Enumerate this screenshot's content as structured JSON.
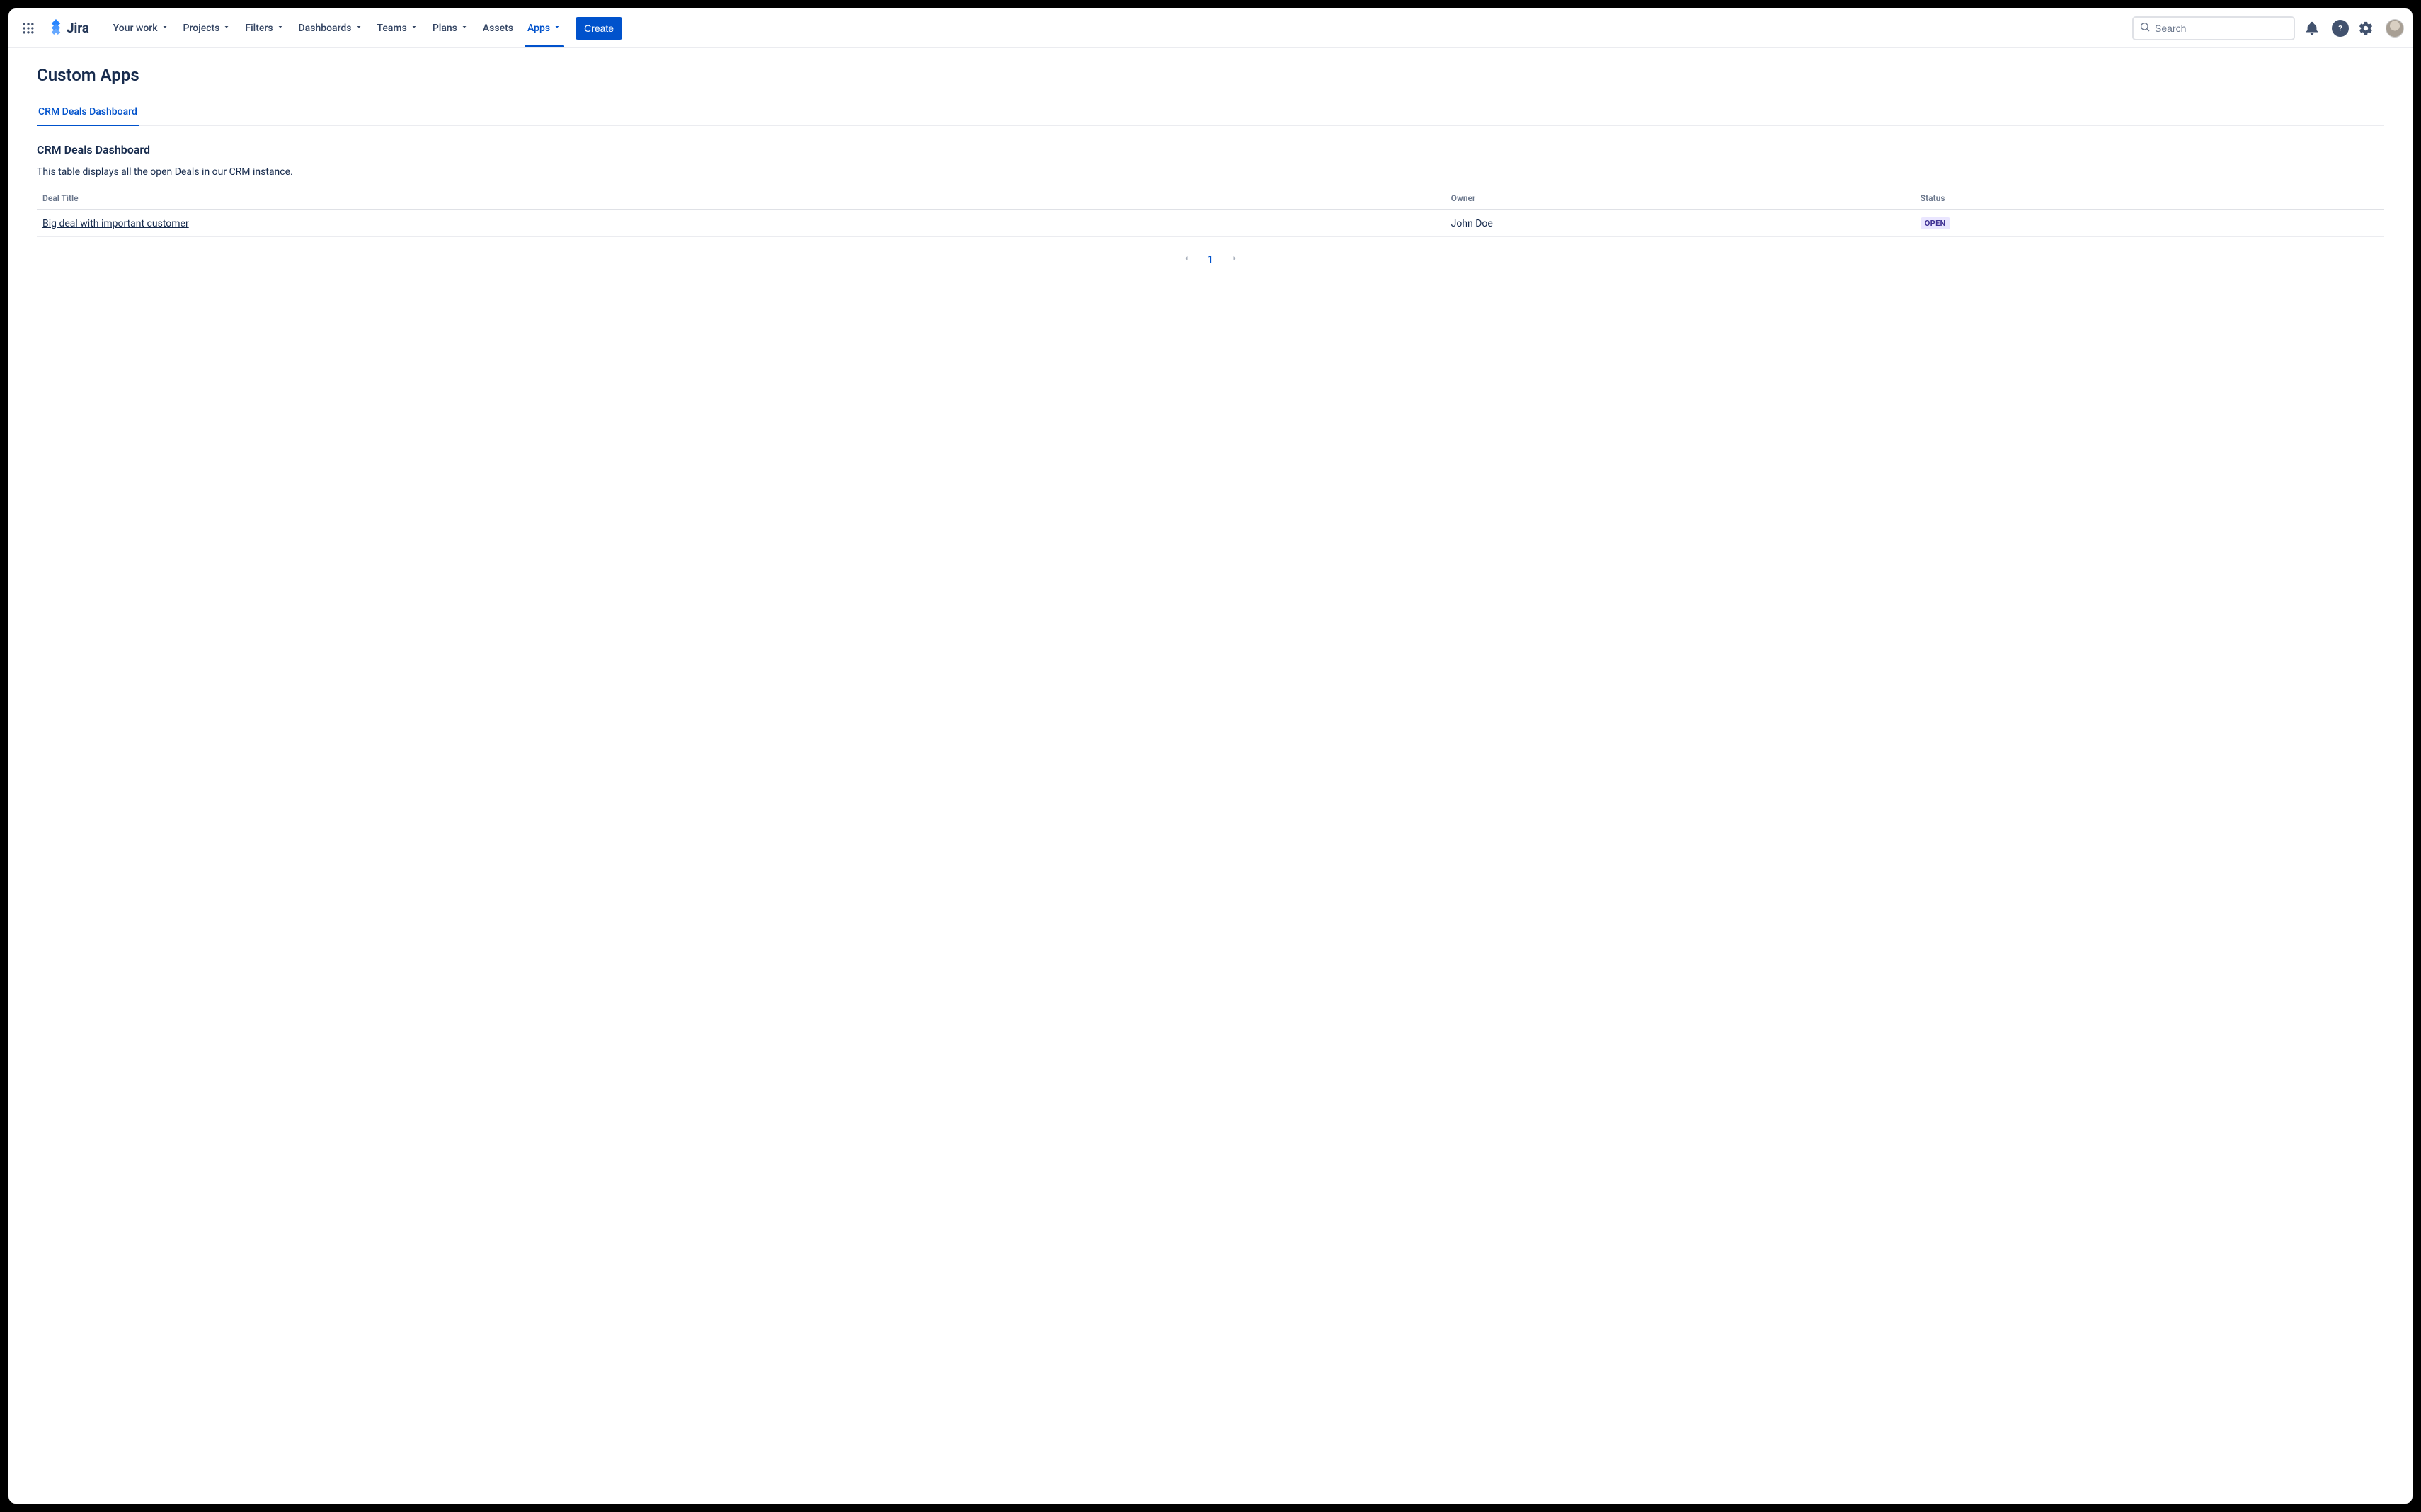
{
  "header": {
    "logo_text": "Jira",
    "nav": [
      {
        "label": "Your work",
        "has_chevron": true,
        "active": false
      },
      {
        "label": "Projects",
        "has_chevron": true,
        "active": false
      },
      {
        "label": "Filters",
        "has_chevron": true,
        "active": false
      },
      {
        "label": "Dashboards",
        "has_chevron": true,
        "active": false
      },
      {
        "label": "Teams",
        "has_chevron": true,
        "active": false
      },
      {
        "label": "Plans",
        "has_chevron": true,
        "active": false
      },
      {
        "label": "Assets",
        "has_chevron": false,
        "active": false
      },
      {
        "label": "Apps",
        "has_chevron": true,
        "active": true
      }
    ],
    "create_label": "Create",
    "search_placeholder": "Search"
  },
  "page": {
    "title": "Custom Apps",
    "tabs": [
      {
        "label": "CRM Deals Dashboard",
        "active": true
      }
    ],
    "section_title": "CRM Deals Dashboard",
    "section_description": "This table displays all the open Deals in our CRM instance.",
    "table": {
      "columns": [
        "Deal Title",
        "Owner",
        "Status"
      ],
      "rows": [
        {
          "title": "Big deal with important customer",
          "owner": "John Doe",
          "status": "OPEN"
        }
      ]
    },
    "pagination": {
      "current": "1"
    }
  }
}
